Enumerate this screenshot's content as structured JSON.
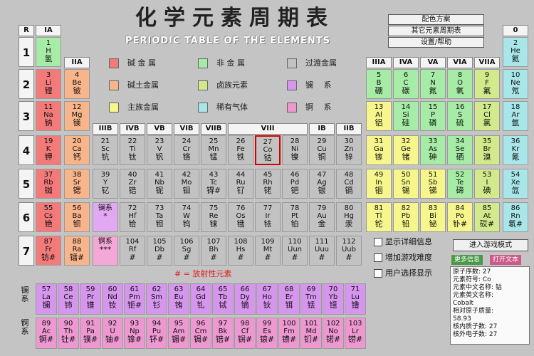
{
  "header": {
    "title": "化学元素周期表",
    "subtitle": "PERIODIC TABLE OF THE ELEMENTS",
    "menu": [
      "配色方案",
      "其它元素周期表",
      "设置/帮助"
    ]
  },
  "group_headers": [
    "IA",
    "IIA",
    "IIIB",
    "IVB",
    "VB",
    "VIB",
    "VIIB",
    "VIII",
    "IB",
    "IIB",
    "IIIA",
    "IVA",
    "VA",
    "VIA",
    "VIIA",
    "0"
  ],
  "period_header": "R",
  "periods": [
    "1",
    "2",
    "3",
    "4",
    "5",
    "6",
    "7"
  ],
  "colors": {
    "alkali": "#f47a7a",
    "alkaline_earth": "#f8b48a",
    "main_group": "#f6f68c",
    "nonmetal": "#a6eba6",
    "metalloid": "#d2ea8c",
    "noble_gas": "#a8e6ea",
    "transition": "#c2c2c2",
    "lanthanide": "#e2a8f2",
    "actinide": "#f4a8d8",
    "lanthanide_row": "#d696ee",
    "actinide_row": "#ee98d2",
    "highlight": "#d00000"
  },
  "legend": [
    {
      "label": "碱 金 属",
      "color": "#f47a7a"
    },
    {
      "label": "碱土金属",
      "color": "#f8b48a"
    },
    {
      "label": "主族金属",
      "color": "#f6f68c"
    },
    {
      "label": "非 金 属",
      "color": "#a6eba6"
    },
    {
      "label": "卤族元素",
      "color": "#d2ea8c"
    },
    {
      "label": "稀有气体",
      "color": "#a8e6ea"
    },
    {
      "label": "过渡金属",
      "color": "#c2c2c2"
    },
    {
      "label": "镧　 系",
      "color": "#d696ee"
    },
    {
      "label": "锕　 系",
      "color": "#ee98d2"
    }
  ],
  "radioactive_note": "# = 放射性元素",
  "series_labels": {
    "lanthanide": "镧系",
    "actinide": "锕系"
  },
  "elements": [
    {
      "n": "1",
      "s": "H",
      "c": "氢",
      "t": "nonmetal",
      "r": 1,
      "g": 1
    },
    {
      "n": "2",
      "s": "He",
      "c": "氦",
      "t": "noble_gas",
      "r": 1,
      "g": 18
    },
    {
      "n": "3",
      "s": "Li",
      "c": "锂",
      "t": "alkali",
      "r": 2,
      "g": 1
    },
    {
      "n": "4",
      "s": "Be",
      "c": "铍",
      "t": "alkaline_earth",
      "r": 2,
      "g": 2
    },
    {
      "n": "5",
      "s": "B",
      "c": "硼",
      "t": "nonmetal",
      "r": 2,
      "g": 13
    },
    {
      "n": "6",
      "s": "C",
      "c": "碳",
      "t": "nonmetal",
      "r": 2,
      "g": 14
    },
    {
      "n": "7",
      "s": "N",
      "c": "氮",
      "t": "nonmetal",
      "r": 2,
      "g": 15
    },
    {
      "n": "8",
      "s": "O",
      "c": "氧",
      "t": "nonmetal",
      "r": 2,
      "g": 16
    },
    {
      "n": "9",
      "s": "F",
      "c": "氟",
      "t": "metalloid",
      "r": 2,
      "g": 17
    },
    {
      "n": "10",
      "s": "Ne",
      "c": "氖",
      "t": "noble_gas",
      "r": 2,
      "g": 18
    },
    {
      "n": "11",
      "s": "Na",
      "c": "钠",
      "t": "alkali",
      "r": 3,
      "g": 1
    },
    {
      "n": "12",
      "s": "Mg",
      "c": "镁",
      "t": "alkaline_earth",
      "r": 3,
      "g": 2
    },
    {
      "n": "13",
      "s": "Al",
      "c": "铝",
      "t": "main_group",
      "r": 3,
      "g": 13
    },
    {
      "n": "14",
      "s": "Si",
      "c": "硅",
      "t": "nonmetal",
      "r": 3,
      "g": 14
    },
    {
      "n": "15",
      "s": "P",
      "c": "磷",
      "t": "nonmetal",
      "r": 3,
      "g": 15
    },
    {
      "n": "16",
      "s": "S",
      "c": "硫",
      "t": "nonmetal",
      "r": 3,
      "g": 16
    },
    {
      "n": "17",
      "s": "Cl",
      "c": "氯",
      "t": "metalloid",
      "r": 3,
      "g": 17
    },
    {
      "n": "18",
      "s": "Ar",
      "c": "氩",
      "t": "noble_gas",
      "r": 3,
      "g": 18
    },
    {
      "n": "19",
      "s": "K",
      "c": "钾",
      "t": "alkali",
      "r": 4,
      "g": 1
    },
    {
      "n": "20",
      "s": "Ca",
      "c": "钙",
      "t": "alkaline_earth",
      "r": 4,
      "g": 2
    },
    {
      "n": "21",
      "s": "Sc",
      "c": "钪",
      "t": "transition",
      "r": 4,
      "g": 3
    },
    {
      "n": "22",
      "s": "Ti",
      "c": "钛",
      "t": "transition",
      "r": 4,
      "g": 4
    },
    {
      "n": "23",
      "s": "V",
      "c": "钒",
      "t": "transition",
      "r": 4,
      "g": 5
    },
    {
      "n": "24",
      "s": "Cr",
      "c": "铬",
      "t": "transition",
      "r": 4,
      "g": 6
    },
    {
      "n": "25",
      "s": "Mn",
      "c": "锰",
      "t": "transition",
      "r": 4,
      "g": 7
    },
    {
      "n": "26",
      "s": "Fe",
      "c": "铁",
      "t": "transition",
      "r": 4,
      "g": 8
    },
    {
      "n": "27",
      "s": "Co",
      "c": "钴",
      "t": "transition",
      "r": 4,
      "g": 9,
      "hl": true
    },
    {
      "n": "28",
      "s": "Ni",
      "c": "镍",
      "t": "transition",
      "r": 4,
      "g": 10
    },
    {
      "n": "29",
      "s": "Cu",
      "c": "铜",
      "t": "transition",
      "r": 4,
      "g": 11
    },
    {
      "n": "30",
      "s": "Zn",
      "c": "锌",
      "t": "transition",
      "r": 4,
      "g": 12
    },
    {
      "n": "31",
      "s": "Ga",
      "c": "镓",
      "t": "main_group",
      "r": 4,
      "g": 13
    },
    {
      "n": "32",
      "s": "Ge",
      "c": "锗",
      "t": "main_group",
      "r": 4,
      "g": 14
    },
    {
      "n": "33",
      "s": "As",
      "c": "砷",
      "t": "nonmetal",
      "r": 4,
      "g": 15
    },
    {
      "n": "34",
      "s": "Se",
      "c": "硒",
      "t": "nonmetal",
      "r": 4,
      "g": 16
    },
    {
      "n": "35",
      "s": "Br",
      "c": "溴",
      "t": "metalloid",
      "r": 4,
      "g": 17
    },
    {
      "n": "36",
      "s": "Kr",
      "c": "氪",
      "t": "noble_gas",
      "r": 4,
      "g": 18
    },
    {
      "n": "37",
      "s": "Rb",
      "c": "铷",
      "t": "alkali",
      "r": 5,
      "g": 1
    },
    {
      "n": "38",
      "s": "Sr",
      "c": "锶",
      "t": "alkaline_earth",
      "r": 5,
      "g": 2
    },
    {
      "n": "39",
      "s": "Y",
      "c": "钇",
      "t": "transition",
      "r": 5,
      "g": 3
    },
    {
      "n": "40",
      "s": "Zr",
      "c": "锆",
      "t": "transition",
      "r": 5,
      "g": 4
    },
    {
      "n": "41",
      "s": "Nb",
      "c": "铌",
      "t": "transition",
      "r": 5,
      "g": 5
    },
    {
      "n": "42",
      "s": "Mo",
      "c": "钼",
      "t": "transition",
      "r": 5,
      "g": 6
    },
    {
      "n": "43",
      "s": "Tc",
      "c": "锝#",
      "t": "transition",
      "r": 5,
      "g": 7
    },
    {
      "n": "44",
      "s": "Ru",
      "c": "钌",
      "t": "transition",
      "r": 5,
      "g": 8
    },
    {
      "n": "45",
      "s": "Rh",
      "c": "铑",
      "t": "transition",
      "r": 5,
      "g": 9
    },
    {
      "n": "46",
      "s": "Pd",
      "c": "钯",
      "t": "transition",
      "r": 5,
      "g": 10
    },
    {
      "n": "47",
      "s": "Ag",
      "c": "银",
      "t": "transition",
      "r": 5,
      "g": 11
    },
    {
      "n": "48",
      "s": "Cd",
      "c": "镉",
      "t": "transition",
      "r": 5,
      "g": 12
    },
    {
      "n": "49",
      "s": "In",
      "c": "铟",
      "t": "main_group",
      "r": 5,
      "g": 13
    },
    {
      "n": "50",
      "s": "Sn",
      "c": "锡",
      "t": "main_group",
      "r": 5,
      "g": 14
    },
    {
      "n": "51",
      "s": "Sb",
      "c": "锑",
      "t": "main_group",
      "r": 5,
      "g": 15
    },
    {
      "n": "52",
      "s": "Te",
      "c": "碲",
      "t": "nonmetal",
      "r": 5,
      "g": 16
    },
    {
      "n": "53",
      "s": "I",
      "c": "碘",
      "t": "metalloid",
      "r": 5,
      "g": 17
    },
    {
      "n": "54",
      "s": "Xe",
      "c": "氙",
      "t": "noble_gas",
      "r": 5,
      "g": 18
    },
    {
      "n": "55",
      "s": "Cs",
      "c": "铯",
      "t": "alkali",
      "r": 6,
      "g": 1
    },
    {
      "n": "56",
      "s": "Ba",
      "c": "钡",
      "t": "alkaline_earth",
      "r": 6,
      "g": 2
    },
    {
      "n": "",
      "s": "镧系",
      "c": "*",
      "t": "lanthanide",
      "r": 6,
      "g": 3
    },
    {
      "n": "72",
      "s": "Hf",
      "c": "铪",
      "t": "transition",
      "r": 6,
      "g": 4
    },
    {
      "n": "73",
      "s": "Ta",
      "c": "钽",
      "t": "transition",
      "r": 6,
      "g": 5
    },
    {
      "n": "74",
      "s": "W",
      "c": "钨",
      "t": "transition",
      "r": 6,
      "g": 6
    },
    {
      "n": "75",
      "s": "Re",
      "c": "铼",
      "t": "transition",
      "r": 6,
      "g": 7
    },
    {
      "n": "76",
      "s": "Os",
      "c": "锇",
      "t": "transition",
      "r": 6,
      "g": 8
    },
    {
      "n": "77",
      "s": "Ir",
      "c": "铱",
      "t": "transition",
      "r": 6,
      "g": 9
    },
    {
      "n": "78",
      "s": "Pt",
      "c": "铂",
      "t": "transition",
      "r": 6,
      "g": 10
    },
    {
      "n": "79",
      "s": "Au",
      "c": "金",
      "t": "transition",
      "r": 6,
      "g": 11
    },
    {
      "n": "80",
      "s": "Hg",
      "c": "汞",
      "t": "transition",
      "r": 6,
      "g": 12
    },
    {
      "n": "81",
      "s": "Tl",
      "c": "铊",
      "t": "main_group",
      "r": 6,
      "g": 13
    },
    {
      "n": "82",
      "s": "Pb",
      "c": "铅",
      "t": "main_group",
      "r": 6,
      "g": 14
    },
    {
      "n": "83",
      "s": "Bi",
      "c": "铋",
      "t": "main_group",
      "r": 6,
      "g": 15
    },
    {
      "n": "84",
      "s": "Po",
      "c": "钋#",
      "t": "main_group",
      "r": 6,
      "g": 16
    },
    {
      "n": "85",
      "s": "At",
      "c": "砹#",
      "t": "metalloid",
      "r": 6,
      "g": 17
    },
    {
      "n": "86",
      "s": "Rn",
      "c": "氡#",
      "t": "noble_gas",
      "r": 6,
      "g": 18
    },
    {
      "n": "87",
      "s": "Fr",
      "c": "钫#",
      "t": "alkali",
      "r": 7,
      "g": 1
    },
    {
      "n": "88",
      "s": "Ra",
      "c": "镭#",
      "t": "alkaline_earth",
      "r": 7,
      "g": 2
    },
    {
      "n": "",
      "s": "锕系",
      "c": "***",
      "t": "actinide",
      "r": 7,
      "g": 3
    },
    {
      "n": "104",
      "s": "Rf",
      "c": "#",
      "t": "transition",
      "r": 7,
      "g": 4
    },
    {
      "n": "105",
      "s": "Db",
      "c": "#",
      "t": "transition",
      "r": 7,
      "g": 5
    },
    {
      "n": "106",
      "s": "Sg",
      "c": "#",
      "t": "transition",
      "r": 7,
      "g": 6
    },
    {
      "n": "107",
      "s": "Bh",
      "c": "#",
      "t": "transition",
      "r": 7,
      "g": 7
    },
    {
      "n": "108",
      "s": "Hs",
      "c": "#",
      "t": "transition",
      "r": 7,
      "g": 8
    },
    {
      "n": "109",
      "s": "Mt",
      "c": "#",
      "t": "transition",
      "r": 7,
      "g": 9
    },
    {
      "n": "110",
      "s": "Uun",
      "c": "#",
      "t": "transition",
      "r": 7,
      "g": 10
    },
    {
      "n": "111",
      "s": "Uuu",
      "c": "#",
      "t": "transition",
      "r": 7,
      "g": 11
    },
    {
      "n": "112",
      "s": "Uub",
      "c": "#",
      "t": "transition",
      "r": 7,
      "g": 12
    }
  ],
  "lanthanides": [
    {
      "n": "57",
      "s": "La",
      "c": "镧"
    },
    {
      "n": "58",
      "s": "Ce",
      "c": "铈"
    },
    {
      "n": "59",
      "s": "Pr",
      "c": "镨"
    },
    {
      "n": "60",
      "s": "Nd",
      "c": "钕"
    },
    {
      "n": "61",
      "s": "Pm",
      "c": "钷#"
    },
    {
      "n": "62",
      "s": "Sm",
      "c": "钐"
    },
    {
      "n": "63",
      "s": "Eu",
      "c": "铕"
    },
    {
      "n": "64",
      "s": "Gd",
      "c": "钆"
    },
    {
      "n": "65",
      "s": "Tb",
      "c": "铽"
    },
    {
      "n": "66",
      "s": "Dy",
      "c": "镝"
    },
    {
      "n": "67",
      "s": "Ho",
      "c": "钬"
    },
    {
      "n": "68",
      "s": "Er",
      "c": "铒"
    },
    {
      "n": "69",
      "s": "Tm",
      "c": "铥"
    },
    {
      "n": "70",
      "s": "Yb",
      "c": "镱"
    },
    {
      "n": "71",
      "s": "Lu",
      "c": "镥"
    }
  ],
  "actinides": [
    {
      "n": "89",
      "s": "Ac",
      "c": "锕#"
    },
    {
      "n": "90",
      "s": "Th",
      "c": "钍#"
    },
    {
      "n": "91",
      "s": "Pa",
      "c": "镤#"
    },
    {
      "n": "92",
      "s": "U",
      "c": "铀#"
    },
    {
      "n": "93",
      "s": "Np",
      "c": "镎#"
    },
    {
      "n": "94",
      "s": "Pu",
      "c": "钚#"
    },
    {
      "n": "95",
      "s": "Am",
      "c": "镅#"
    },
    {
      "n": "96",
      "s": "Cm",
      "c": "锔#"
    },
    {
      "n": "97",
      "s": "Bk",
      "c": "锫#"
    },
    {
      "n": "98",
      "s": "Cf",
      "c": "锎#"
    },
    {
      "n": "99",
      "s": "Es",
      "c": "锿#"
    },
    {
      "n": "100",
      "s": "Fm",
      "c": "镄#"
    },
    {
      "n": "101",
      "s": "Md",
      "c": "钔#"
    },
    {
      "n": "102",
      "s": "No",
      "c": "锘#"
    },
    {
      "n": "103",
      "s": "Lr",
      "c": "铹#"
    }
  ],
  "options": {
    "items": [
      "显示详细信息",
      "增加游戏难度",
      "用户选择显示"
    ],
    "game_button": "进入游戏模式",
    "more_info_button": "更多信息",
    "print_button": "打开文本"
  },
  "info_panel": {
    "lines": [
      "原子序数: 27",
      "元素符号: Co",
      "元素中文名称: 钴",
      "元素英文名称:",
      "Cobalt",
      "相对原子质量:",
      "58.93",
      "核内质子数: 27",
      "核外电子数: 27"
    ]
  }
}
